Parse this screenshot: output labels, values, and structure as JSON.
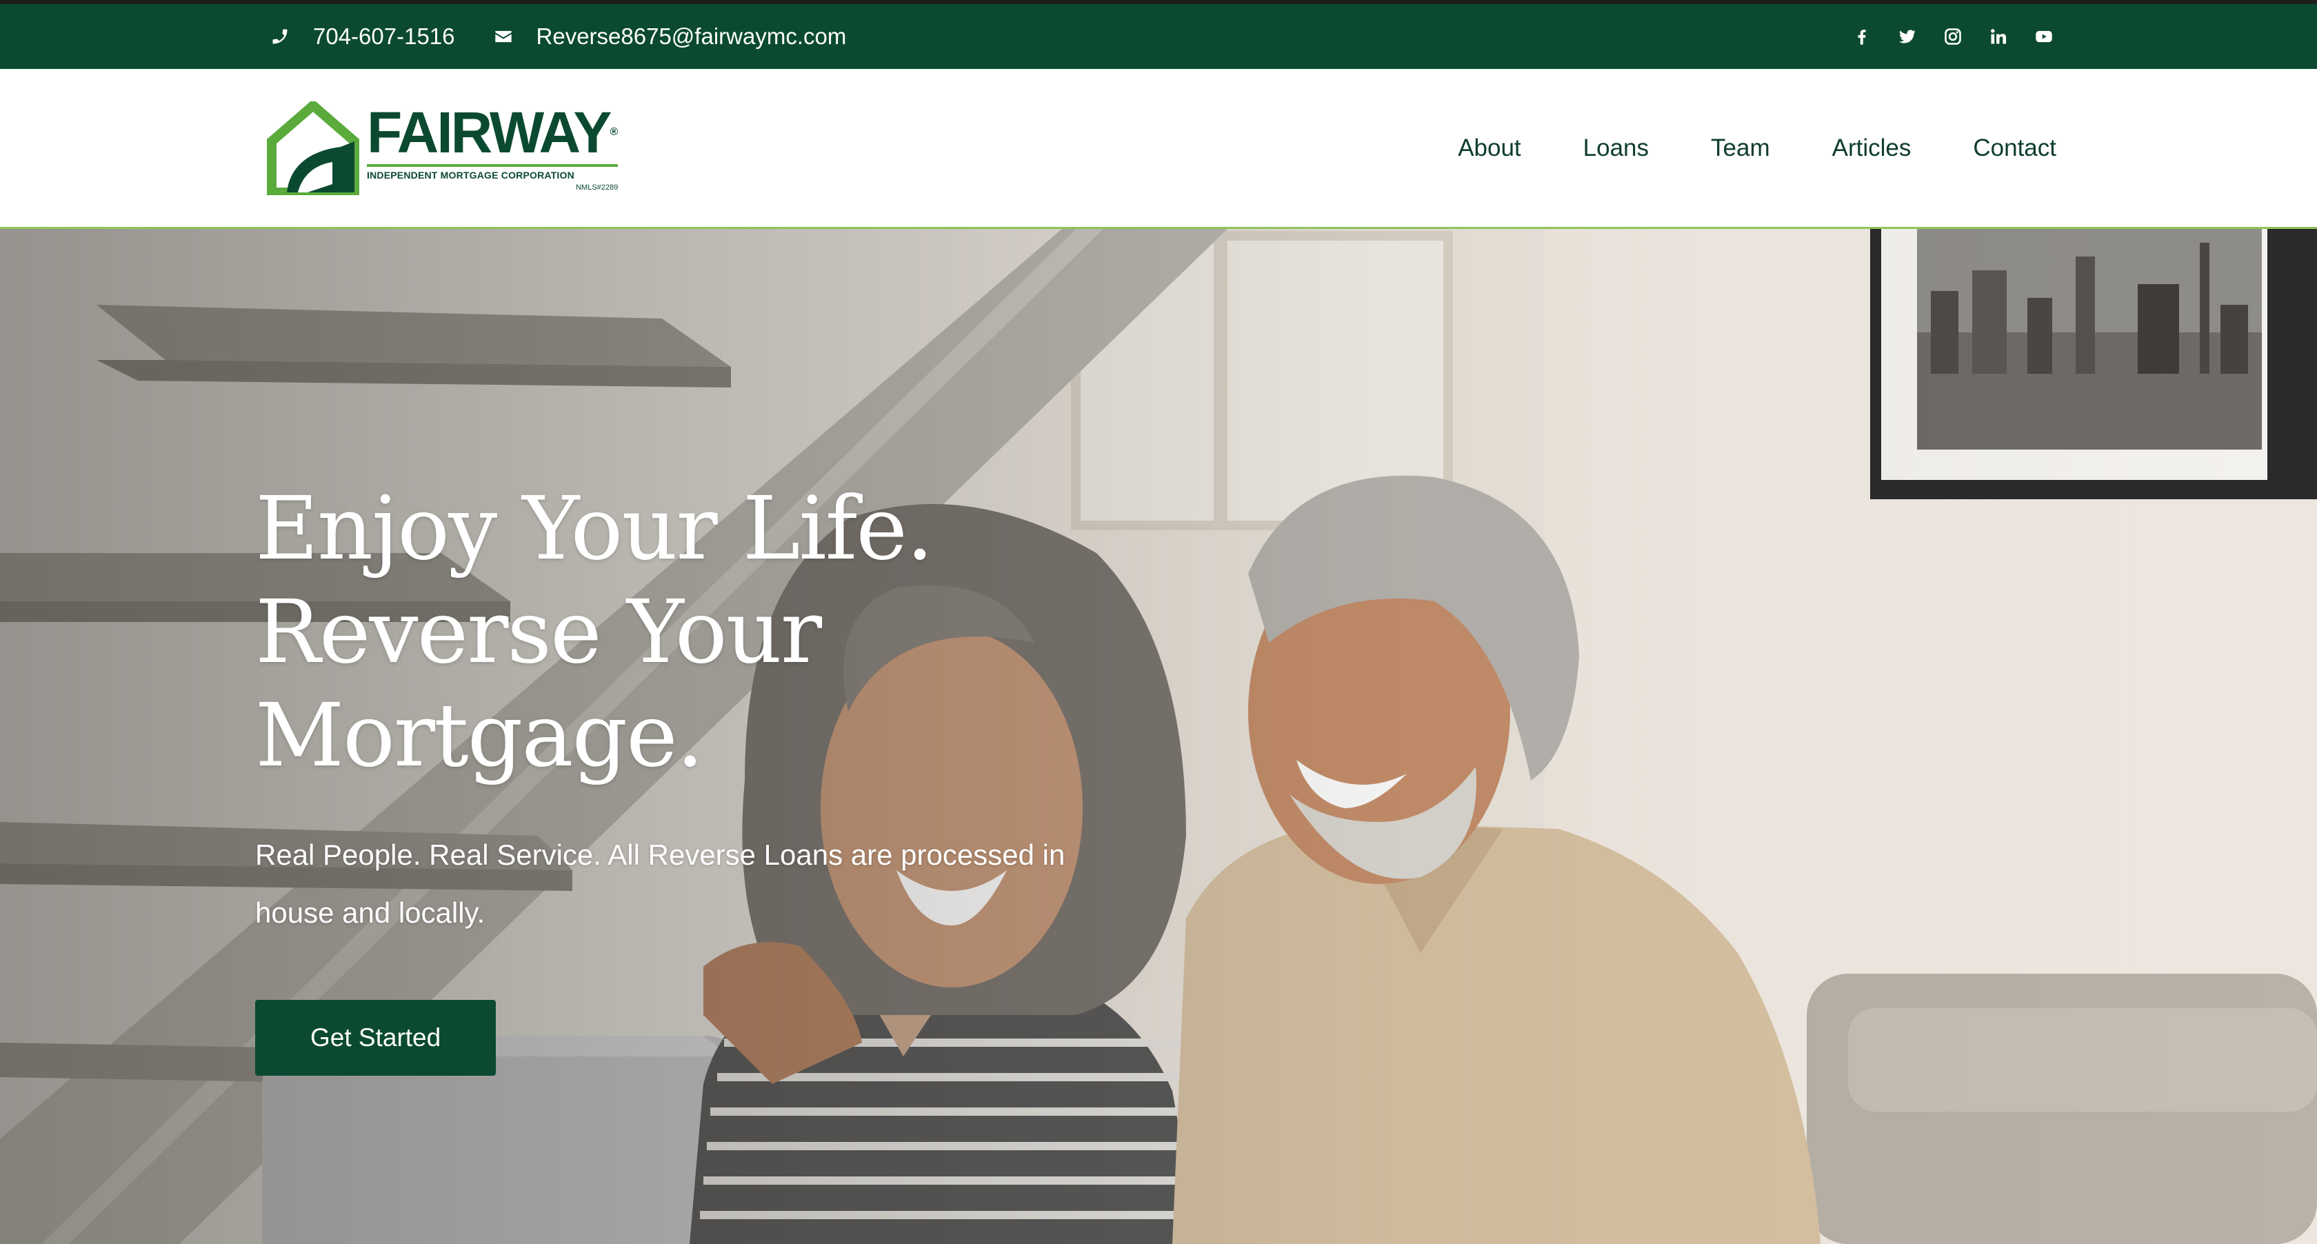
{
  "topbar": {
    "phone": "704-607-1516",
    "email": "Reverse8675@fairwaymc.com",
    "phone_icon": "phone-icon",
    "email_icon": "envelope-icon",
    "socials": [
      "facebook-icon",
      "twitter-icon",
      "instagram-icon",
      "linkedin-icon",
      "youtube-icon"
    ]
  },
  "header": {
    "logo_word": "FAIRWAY",
    "logo_registered": "®",
    "logo_sub": "INDEPENDENT MORTGAGE CORPORATION",
    "logo_nmls": "NMLS#2289",
    "nav": [
      "About",
      "Loans",
      "Team",
      "Articles",
      "Contact"
    ]
  },
  "hero": {
    "title_line1": "Enjoy Your Life.",
    "title_line2": "Reverse Your Mortgage.",
    "subtitle": "Real People. Real Service. All Reverse Loans are processed in house and locally.",
    "cta_label": "Get Started"
  },
  "colors": {
    "brand_green": "#0b4a30",
    "accent_green": "#5aab3c",
    "header_border": "#8fc45a"
  }
}
